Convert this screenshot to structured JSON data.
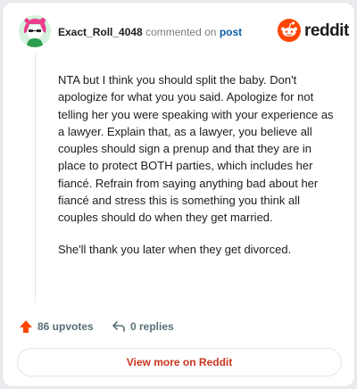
{
  "header": {
    "username": "Exact_Roll_4048",
    "action_text": "commented on",
    "post_link": "post",
    "logo_text": "reddit"
  },
  "comment": {
    "paragraphs": [
      "NTA but I think you should split the baby. Don't apologize for what you you said. Apologize for not telling her you were speaking with your experience as a lawyer. Explain that, as a lawyer, you believe all couples should sign a prenup and that they are in place to protect BOTH parties, which includes her fiancé. Refrain from saying anything bad about her fiancé and stress this is something you think all couples should do when they get married.",
      "She'll thank you later when they get divorced."
    ]
  },
  "actions": {
    "upvotes": "86 upvotes",
    "replies": "0 replies"
  },
  "footer": {
    "view_more": "View more on Reddit"
  },
  "colors": {
    "reddit_orange": "#ff4500",
    "link_blue": "#0a5ea8",
    "view_more_red": "#c8321c"
  },
  "icons": {
    "avatar": "snoo-avatar",
    "logo": "reddit-snoo-icon",
    "upvote": "upvote-arrow-icon",
    "reply": "reply-arrow-icon"
  }
}
